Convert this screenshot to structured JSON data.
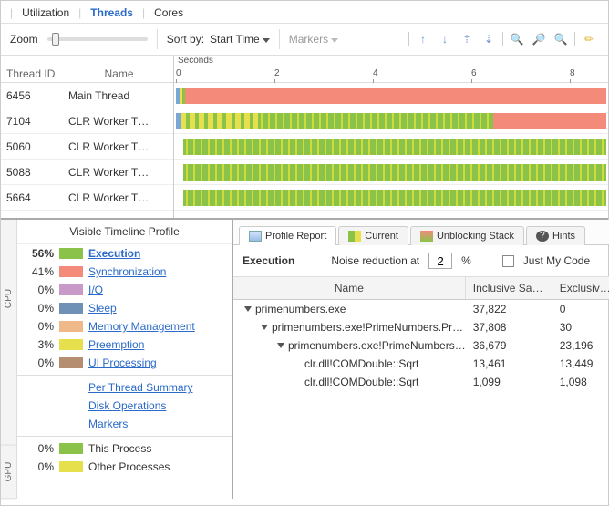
{
  "tabs": {
    "utilization": "Utilization",
    "threads": "Threads",
    "cores": "Cores"
  },
  "toolbar": {
    "zoom": "Zoom",
    "sortby_label": "Sort by:",
    "sortby_value": "Start Time",
    "markers": "Markers"
  },
  "ruler": {
    "label": "Seconds",
    "ticks": [
      "0",
      "2",
      "4",
      "6",
      "8"
    ]
  },
  "thread_table": {
    "headers": {
      "id": "Thread ID",
      "name": "Name"
    },
    "rows": [
      {
        "id": "6456",
        "name": "Main Thread"
      },
      {
        "id": "7104",
        "name": "CLR Worker T…"
      },
      {
        "id": "5060",
        "name": "CLR Worker T…"
      },
      {
        "id": "5088",
        "name": "CLR Worker T…"
      },
      {
        "id": "5664",
        "name": "CLR Worker T…"
      }
    ]
  },
  "profile": {
    "title": "Visible Timeline Profile",
    "groups": {
      "cpu": "CPU",
      "blank": "",
      "gpu": "GPU"
    },
    "legend": [
      {
        "pct": "56%",
        "color": "#8bc34a",
        "label": "Execution",
        "bold": true
      },
      {
        "pct": "41%",
        "color": "#f48a7a",
        "label": "Synchronization"
      },
      {
        "pct": "0%",
        "color": "#c99ac7",
        "label": "I/O"
      },
      {
        "pct": "0%",
        "color": "#6f91b6",
        "label": "Sleep"
      },
      {
        "pct": "0%",
        "color": "#f0b98a",
        "label": "Memory Management"
      },
      {
        "pct": "3%",
        "color": "#e6e04d",
        "label": "Preemption"
      },
      {
        "pct": "0%",
        "color": "#b58e72",
        "label": "UI Processing"
      }
    ],
    "links": {
      "per_thread": "Per Thread Summary",
      "disk_ops": "Disk Operations",
      "markers": "Markers"
    },
    "gpu": [
      {
        "pct": "0%",
        "color": "#8bc34a",
        "label": "This Process"
      },
      {
        "pct": "0%",
        "color": "#e6e04d",
        "label": "Other Processes"
      }
    ]
  },
  "report": {
    "tabs": {
      "profile": "Profile Report",
      "current": "Current",
      "unblocking": "Unblocking Stack",
      "hints": "Hints"
    },
    "noise": {
      "title": "Execution",
      "label": "Noise reduction at",
      "value": "2",
      "pct": "%",
      "just_my_code": "Just My Code"
    },
    "headers": {
      "name": "Name",
      "inclusive": "Inclusive Sam…",
      "exclusive": "Exclusive…"
    },
    "rows": [
      {
        "indent": 0,
        "expand": true,
        "name": "primenumbers.exe",
        "inc": "37,822",
        "exc": "0"
      },
      {
        "indent": 1,
        "expand": true,
        "name": "primenumbers.exe!PrimeNumbers.Pr…",
        "inc": "37,808",
        "exc": "30"
      },
      {
        "indent": 2,
        "expand": true,
        "name": "primenumbers.exe!PrimeNumbers…",
        "inc": "36,679",
        "exc": "23,196"
      },
      {
        "indent": 3,
        "expand": false,
        "name": "clr.dll!COMDouble::Sqrt",
        "inc": "13,461",
        "exc": "13,449"
      },
      {
        "indent": 3,
        "expand": false,
        "name": "clr.dll!COMDouble::Sqrt",
        "inc": "1,099",
        "exc": "1,098"
      }
    ]
  }
}
